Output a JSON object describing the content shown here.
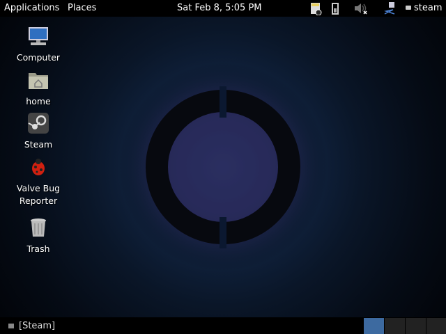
{
  "topbar": {
    "applications": "Applications",
    "places": "Places",
    "clock": "Sat Feb  8,  5:05 PM",
    "user": "steam",
    "indicators": [
      "notes-icon",
      "battery-icon",
      "volume-muted-icon",
      "network-icon"
    ]
  },
  "desktop_icons": [
    {
      "label": "Computer",
      "icon": "computer-icon"
    },
    {
      "label": "home",
      "icon": "home-folder-icon"
    },
    {
      "label": "Steam",
      "icon": "steam-icon"
    },
    {
      "label": "Valve Bug\nReporter",
      "line1": "Valve Bug",
      "line2": "Reporter",
      "icon": "bug-icon"
    },
    {
      "label": "Trash",
      "icon": "trash-icon"
    }
  ],
  "taskbar": {
    "window_label": "[Steam]",
    "workspaces": 4,
    "active_workspace": 1
  },
  "colors": {
    "workspace_active": "#3d6aa0"
  }
}
